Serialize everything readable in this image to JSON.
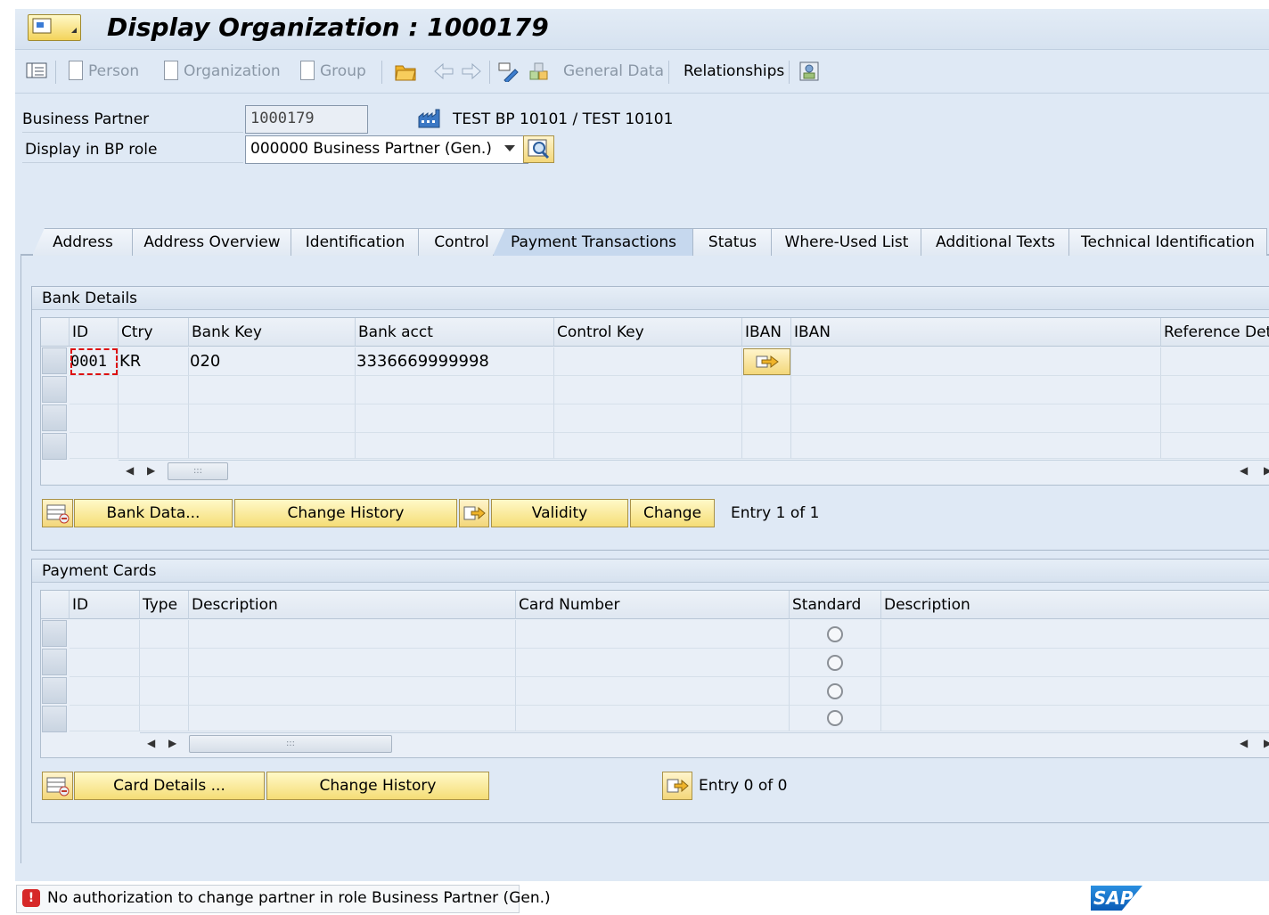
{
  "window": {
    "title": "Display Organization : 1000179"
  },
  "toolbar": {
    "person": "Person",
    "organization": "Organization",
    "group": "Group",
    "general_data": "General Data",
    "relationships": "Relationships"
  },
  "header": {
    "bp_label": "Business Partner",
    "bp_value": "1000179",
    "bp_name": "TEST BP 10101 / TEST 10101",
    "role_label": "Display in BP role",
    "role_value": "000000 Business Partner (Gen.)"
  },
  "tabs": [
    {
      "label": "Address"
    },
    {
      "label": "Address Overview"
    },
    {
      "label": "Identification"
    },
    {
      "label": "Control"
    },
    {
      "label": "Payment Transactions",
      "active": true
    },
    {
      "label": "Status"
    },
    {
      "label": "Where-Used List"
    },
    {
      "label": "Additional Texts"
    },
    {
      "label": "Technical Identification"
    }
  ],
  "bank_details": {
    "title": "Bank Details",
    "columns": [
      "ID",
      "Ctry",
      "Bank Key",
      "Bank acct",
      "Control Key",
      "IBAN",
      "IBAN",
      "Reference Deta"
    ],
    "rows": [
      {
        "id": "0001",
        "ctry": "KR",
        "bank_key": "020",
        "bank_acct": "3336669999998",
        "control_key": "",
        "iban": "",
        "reference": ""
      }
    ],
    "buttons": {
      "bank_data": "Bank Data...",
      "change_history": "Change History",
      "validity": "Validity",
      "change": "Change"
    },
    "entry_text": "Entry 1 of 1"
  },
  "payment_cards": {
    "title": "Payment Cards",
    "columns": [
      "ID",
      "Type",
      "Description",
      "Card Number",
      "Standard",
      "Description"
    ],
    "buttons": {
      "card_details": "Card Details ...",
      "change_history": "Change History"
    },
    "entry_text": "Entry 0 of 0"
  },
  "status": {
    "message": "No authorization to change partner in role Business Partner (Gen.)",
    "type": "error"
  },
  "brand": {
    "logo_text": "SAP",
    "accent": "#f5dd76"
  }
}
